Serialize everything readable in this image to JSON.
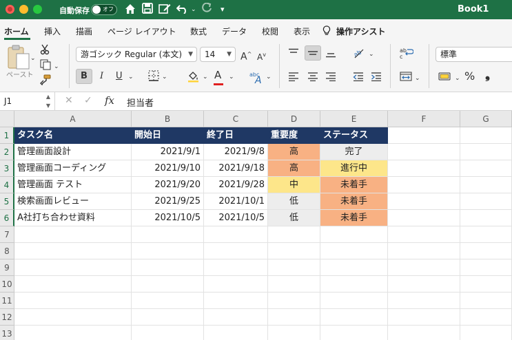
{
  "titlebar": {
    "autosave_label": "自動保存",
    "autosave_state": "オフ",
    "book_title": "Book1",
    "colors": {
      "titlebar_bg": "#1e7145"
    },
    "icons": [
      "home-icon",
      "save-icon",
      "edit-icon",
      "undo-icon",
      "redo-icon",
      "customize-icon"
    ]
  },
  "menu": {
    "tabs": [
      "ホーム",
      "挿入",
      "描画",
      "ページ レイアウト",
      "数式",
      "データ",
      "校閲",
      "表示"
    ],
    "assist": "操作アシスト",
    "active_index": 0
  },
  "ribbon": {
    "paste_label": "ペースト",
    "font_name": "游ゴシック Regular (本文)",
    "font_size": "14",
    "grow_font": "A",
    "shrink_font": "A",
    "bold": "B",
    "italic": "I",
    "underline": "U",
    "font_color": "A",
    "text_direction": "abc",
    "number_format": "標準",
    "percent": "%",
    "comma": "❟"
  },
  "formula_bar": {
    "name_box": "J1",
    "fx": "fx",
    "content": "担当者"
  },
  "sheet": {
    "columns": [
      "A",
      "B",
      "C",
      "D",
      "E",
      "F",
      "G"
    ],
    "rows": [
      "1",
      "2",
      "3",
      "4",
      "5",
      "6",
      "7",
      "8",
      "9",
      "10",
      "11",
      "12",
      "13"
    ],
    "header": [
      "タスク名",
      "開始日",
      "終了日",
      "重要度",
      "ステータス"
    ],
    "data": [
      [
        "管理画面設計",
        "2021/9/1",
        "2021/9/8",
        "高",
        "完了"
      ],
      [
        "管理画面コーディング",
        "2021/9/10",
        "2021/9/18",
        "高",
        "進行中"
      ],
      [
        "管理画面 テスト",
        "2021/9/20",
        "2021/9/28",
        "中",
        "未着手"
      ],
      [
        "検索画面レビュー",
        "2021/9/25",
        "2021/10/1",
        "低",
        "未着手"
      ],
      [
        "A社打ち合わせ資料",
        "2021/10/5",
        "2021/10/5",
        "低",
        "未着手"
      ]
    ],
    "colors": {
      "header_bg": "#1f3864",
      "high": "#f8b183",
      "medium": "#fde68a",
      "low": "#ededed",
      "done": "#ededed",
      "in_progress": "#fde68a",
      "not_started": "#f8b183"
    }
  }
}
